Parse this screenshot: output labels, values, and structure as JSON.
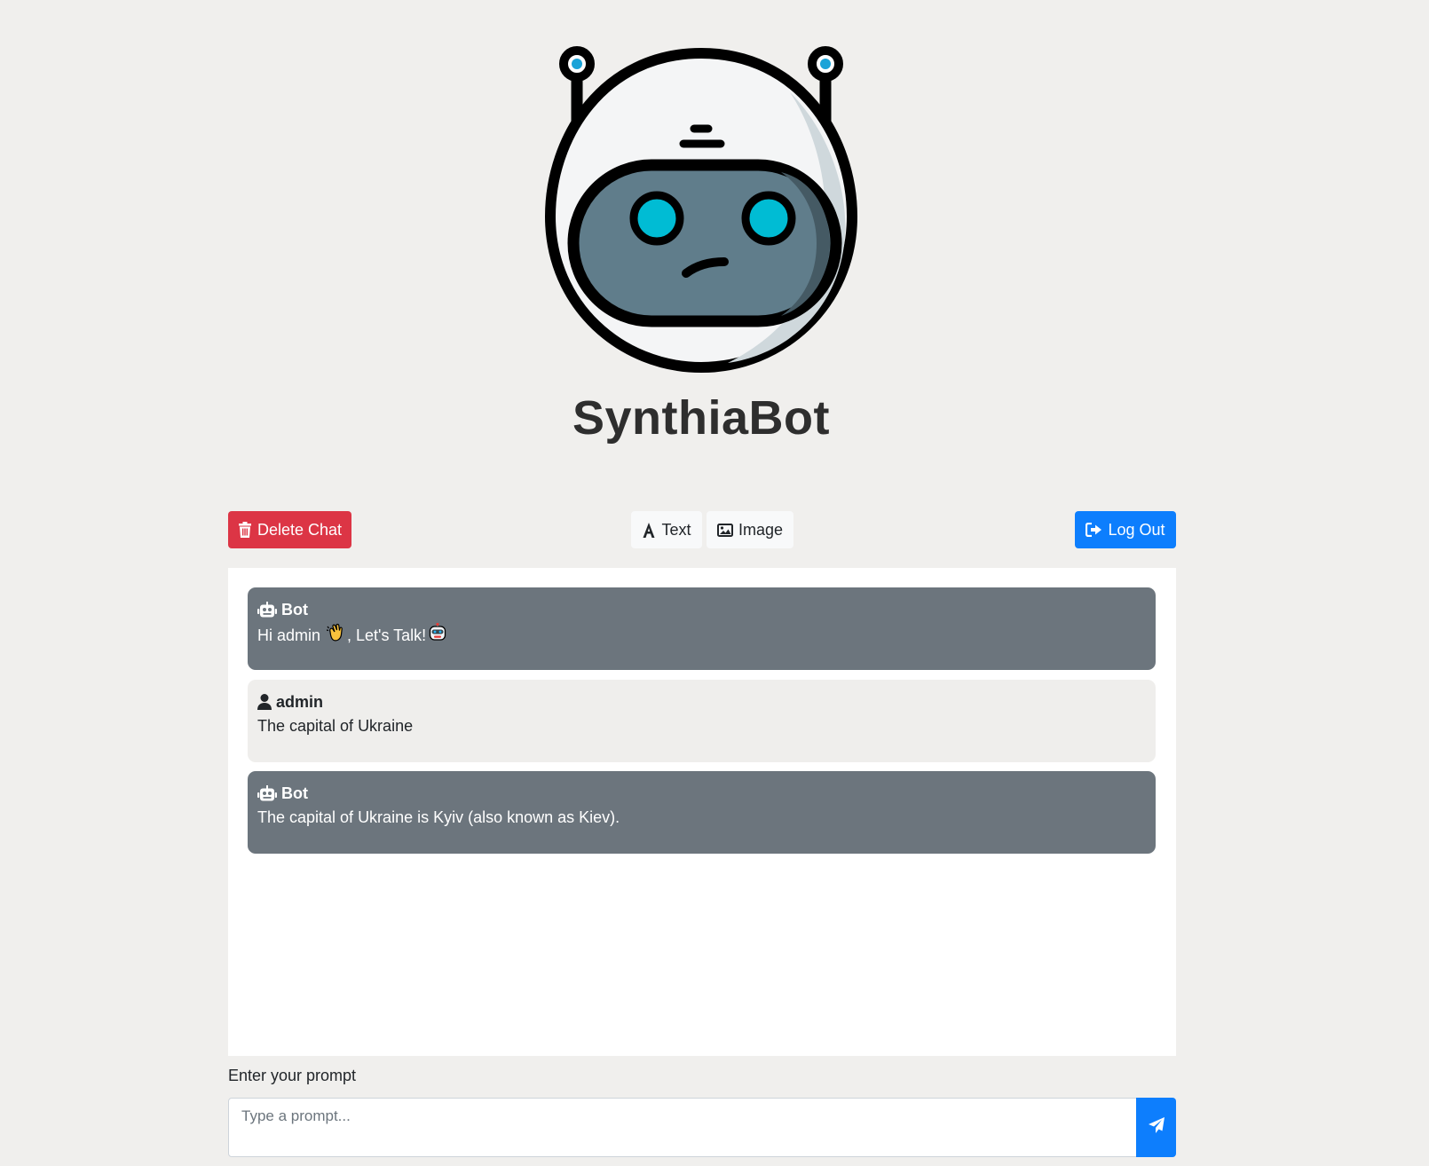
{
  "app": {
    "title": "SynthiaBot",
    "logo_icon": "robot-head-logo"
  },
  "toolbar": {
    "delete_label": "Delete Chat",
    "delete_icon": "trash-icon",
    "text_label": "Text",
    "text_icon": "font-icon",
    "image_label": "Image",
    "image_icon": "image-icon",
    "logout_label": "Log Out",
    "logout_icon": "sign-out-icon"
  },
  "chat": {
    "messages": [
      {
        "role": "bot",
        "sender": "Bot",
        "icon": "robot-icon",
        "text": "Hi admin",
        "text_suffix": ", Let's Talk!",
        "emojis": [
          "waving-hand",
          "robot-face"
        ]
      },
      {
        "role": "user",
        "sender": "admin",
        "icon": "user-icon",
        "text": "The capital of Ukraine"
      },
      {
        "role": "bot",
        "sender": "Bot",
        "icon": "robot-icon",
        "text": "The capital of Ukraine is Kyiv (also known as Kiev)."
      }
    ]
  },
  "prompt": {
    "label": "Enter your prompt",
    "placeholder": "Type a prompt...",
    "send_icon": "paper-plane-icon"
  },
  "colors": {
    "background": "#f0efed",
    "danger": "#dc3545",
    "primary": "#0d7efd",
    "bot_bubble": "#6c757d",
    "user_bubble": "#efeeec"
  }
}
